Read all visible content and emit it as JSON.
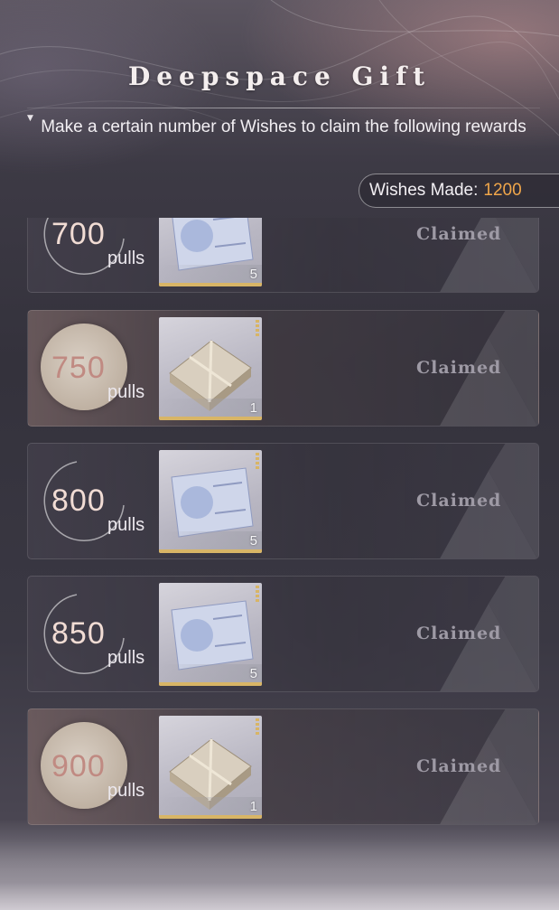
{
  "header": {
    "title": "Deepspace Gift",
    "subtitle": "Make a certain number of Wishes to claim the following rewards"
  },
  "wishes": {
    "label": "Wishes Made:",
    "value": "1200",
    "value_color": "#f0a64a"
  },
  "rewards": [
    {
      "pulls": "700",
      "unit": "pulls",
      "item_icon": "ticket-card-icon",
      "count": "5",
      "status": "Claimed",
      "badge_style": "ring"
    },
    {
      "pulls": "750",
      "unit": "pulls",
      "item_icon": "gift-box-icon",
      "count": "1",
      "status": "Claimed",
      "badge_style": "disc"
    },
    {
      "pulls": "800",
      "unit": "pulls",
      "item_icon": "ticket-card-icon",
      "count": "5",
      "status": "Claimed",
      "badge_style": "ring"
    },
    {
      "pulls": "850",
      "unit": "pulls",
      "item_icon": "ticket-card-icon",
      "count": "5",
      "status": "Claimed",
      "badge_style": "ring"
    },
    {
      "pulls": "900",
      "unit": "pulls",
      "item_icon": "gift-box-icon",
      "count": "1",
      "status": "Claimed",
      "badge_style": "disc"
    }
  ]
}
